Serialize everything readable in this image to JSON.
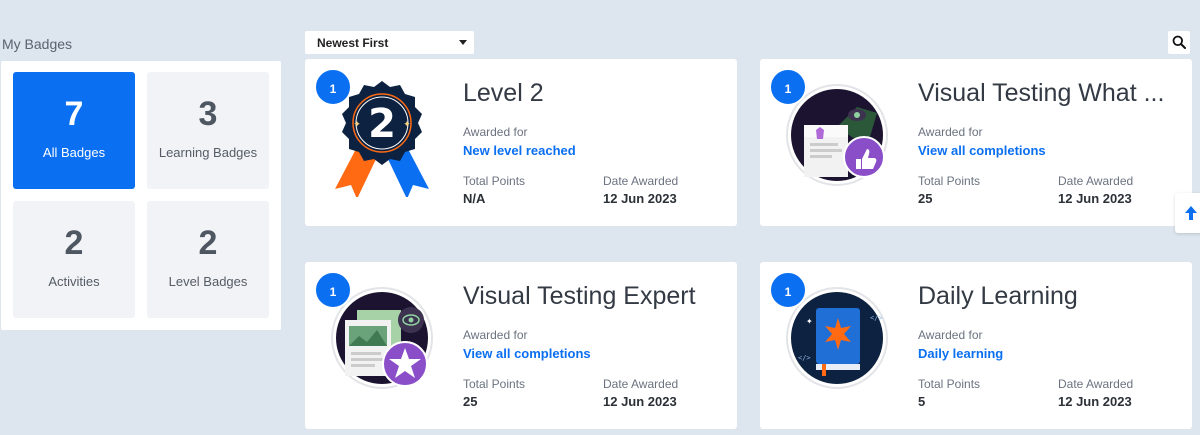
{
  "sidebar": {
    "title": "My Badges",
    "tiles": [
      {
        "count": "7",
        "label": "All Badges",
        "active": true
      },
      {
        "count": "3",
        "label": "Learning Badges",
        "active": false
      },
      {
        "count": "2",
        "label": "Activities",
        "active": false
      },
      {
        "count": "2",
        "label": "Level Badges",
        "active": false
      }
    ]
  },
  "toolbar": {
    "sort_value": "Newest First",
    "search_icon": "search-icon"
  },
  "labels": {
    "awarded_for": "Awarded for",
    "total_points": "Total Points",
    "date_awarded": "Date Awarded"
  },
  "cards": [
    {
      "count": "1",
      "title": "Level 2",
      "awarded_for_link": "New level reached",
      "points": "N/A",
      "date": "12 Jun 2023",
      "icon": "level-2-rosette-icon"
    },
    {
      "count": "1",
      "title": "Visual Testing What ...",
      "awarded_for_link": "View all completions",
      "points": "25",
      "date": "12 Jun 2023",
      "icon": "visual-testing-thumbs-up-icon"
    },
    {
      "count": "1",
      "title": "Visual Testing Expert",
      "awarded_for_link": "View all completions",
      "points": "25",
      "date": "12 Jun 2023",
      "icon": "visual-testing-star-icon"
    },
    {
      "count": "1",
      "title": "Daily Learning",
      "awarded_for_link": "Daily learning",
      "points": "5",
      "date": "12 Jun 2023",
      "icon": "book-icon"
    }
  ],
  "colors": {
    "accent": "#0a6ff1",
    "background": "#dde5ee",
    "tile_bg": "#f1f3f6",
    "dark_navy": "#0d2240",
    "purple": "#8a4fc8",
    "orange": "#ff6a13"
  },
  "scroll_top_icon": "arrow-up-icon"
}
